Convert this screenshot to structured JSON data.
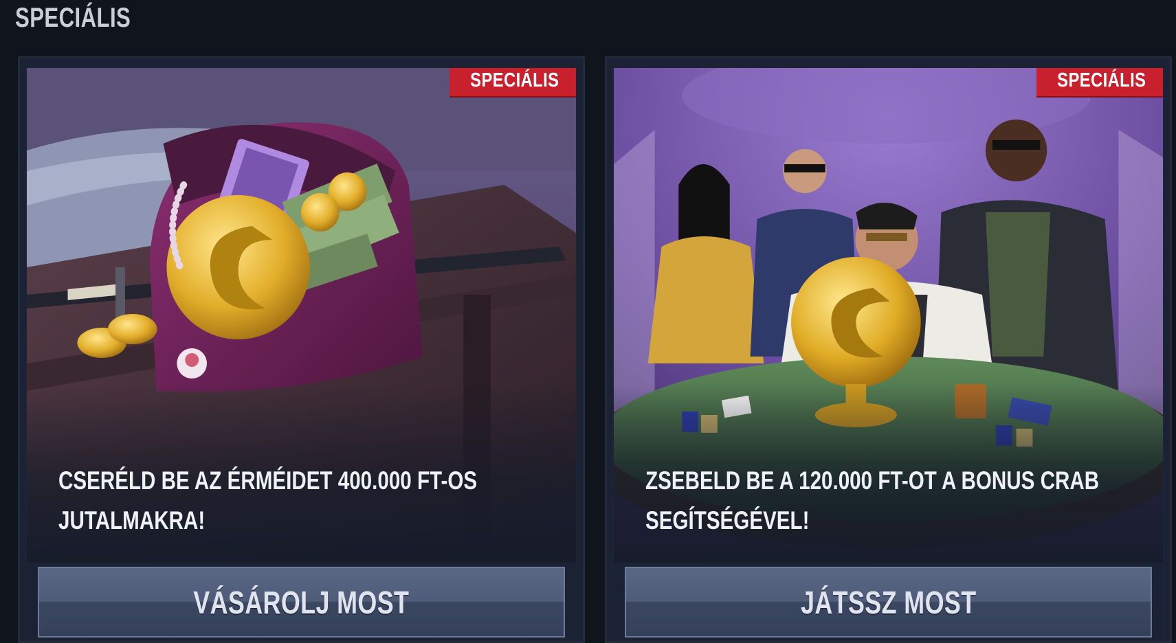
{
  "section": {
    "title": "SPECIÁLIS"
  },
  "cards": [
    {
      "badge": "SPECIÁLIS",
      "headline_line1": "CSERÉLD BE AZ ÉRMÉIDET 400.000 FT-OS",
      "headline_line2": "JUTALMAKRA!",
      "cta": "VÁSÁROLJ MOST",
      "art_icon": "purse-with-coins-and-cash"
    },
    {
      "badge": "SPECIÁLIS",
      "headline_line1": "ZSEBELD BE A 120.000 FT-OT A BONUS CRAB",
      "headline_line2": "SEGÍTSÉGÉVEL!",
      "cta": "JÁTSSZ MOST",
      "art_icon": "gangsters-poker-table-trophy"
    }
  ],
  "colors": {
    "page_bg": "#10141c",
    "badge_red": "#c8202c",
    "cta_blue": "#4f5c79"
  }
}
